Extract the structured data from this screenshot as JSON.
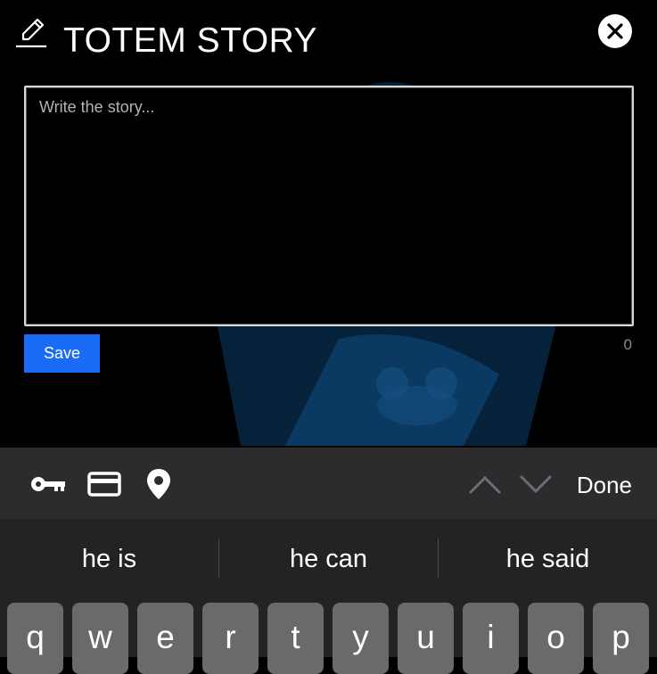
{
  "header": {
    "title": "TOTEM STORY"
  },
  "story": {
    "placeholder": "Write the story...",
    "value": ""
  },
  "save_label": "Save",
  "char_count": "0",
  "toolbar": {
    "done_label": "Done",
    "icons": [
      "key-icon",
      "credit-card-icon",
      "location-pin-icon",
      "chevron-up-icon",
      "chevron-down-icon"
    ]
  },
  "suggestions": [
    "he is",
    "he can",
    "he said"
  ],
  "keys": [
    "q",
    "w",
    "e",
    "r",
    "t",
    "y",
    "u",
    "i",
    "o",
    "p"
  ],
  "colors": {
    "accent": "#1a6cf7",
    "toolbar": "#2c2c2e",
    "keyboard": "#232325",
    "key": "#6a6a6d"
  }
}
